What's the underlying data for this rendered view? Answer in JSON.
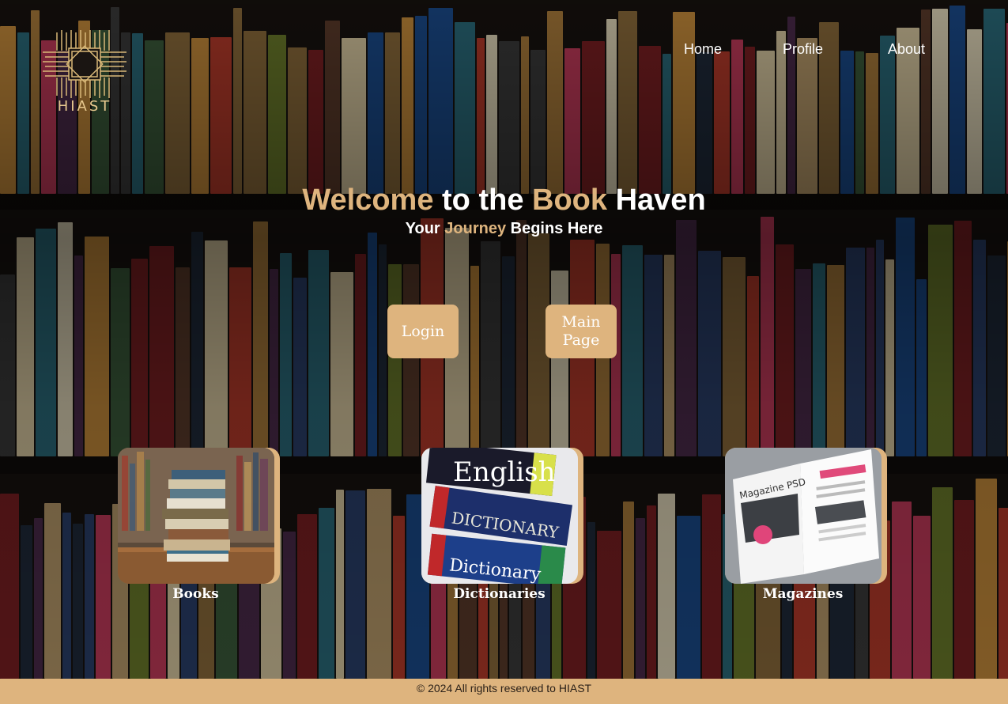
{
  "brand": {
    "logo_text": "HIAST"
  },
  "nav": {
    "items": [
      {
        "label": "Home"
      },
      {
        "label": "Profile"
      },
      {
        "label": "About"
      }
    ]
  },
  "hero": {
    "title_w1": "Welcome",
    "title_w2": "to the",
    "title_w3": "Book",
    "title_w4": "Haven",
    "sub_w1": "Your",
    "sub_w2": "Journey",
    "sub_w3": "Begins Here"
  },
  "buttons": {
    "login": "Login",
    "main_page": "Main Page"
  },
  "categories": [
    {
      "label": "Books"
    },
    {
      "label": "Dictionaries"
    },
    {
      "label": "Magazines"
    }
  ],
  "dictionary_cover": {
    "line1": "English",
    "line2": "DICTIONARY",
    "line3": "Dictionary"
  },
  "magazine_cover": {
    "title": "Magazine PSD"
  },
  "footer": {
    "text": "© 2024 All rights reserved to HIAST"
  },
  "colors": {
    "accent": "#deb47e",
    "footer_bg": "#deb47e",
    "text": "#ffffff"
  }
}
